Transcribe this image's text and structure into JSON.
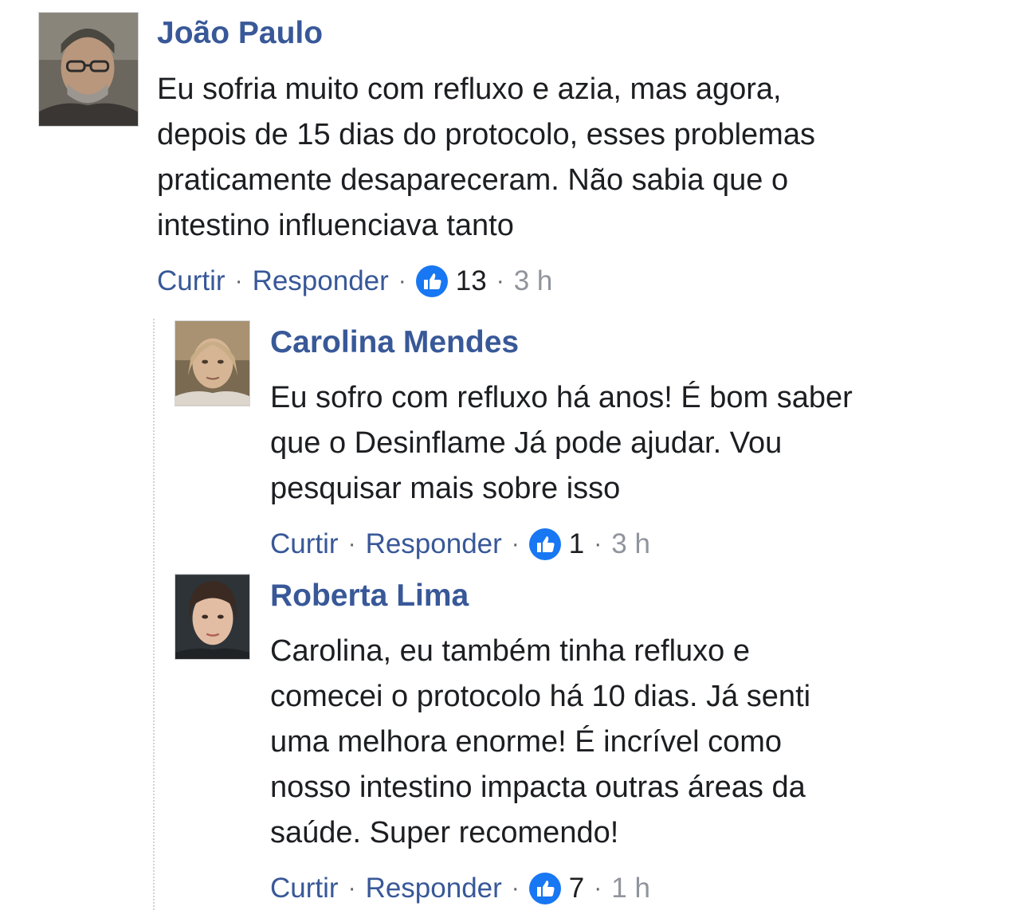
{
  "comments": [
    {
      "author": "João Paulo",
      "lines": [
        "Eu sofria muito com refluxo e azia, mas agora,",
        "depois de 15 dias do protocolo, esses problemas",
        "praticamente desapareceram. Não sabia que o",
        "intestino influenciava tanto"
      ],
      "like_label": "Curtir",
      "reply_label": "Responder",
      "separator": "·",
      "reaction_icon": "thumbs-up-icon",
      "reaction_count": "13",
      "time": "3 h"
    }
  ],
  "replies": [
    {
      "author": "Carolina Mendes",
      "lines": [
        "Eu sofro com refluxo há anos! É bom saber",
        "que o Desinflame Já pode ajudar. Vou",
        "pesquisar mais sobre isso"
      ],
      "like_label": "Curtir",
      "reply_label": "Responder",
      "separator": "·",
      "reaction_icon": "thumbs-up-icon",
      "reaction_count": "1",
      "time": "3 h"
    },
    {
      "author": "Roberta Lima",
      "lines": [
        "Carolina, eu também tinha refluxo e",
        "comecei o protocolo há 10 dias. Já senti",
        "uma melhora enorme! É incrível como",
        "nosso intestino impacta outras áreas da",
        "saúde. Super recomendo!"
      ],
      "like_label": "Curtir",
      "reply_label": "Responder",
      "separator": "·",
      "reaction_icon": "thumbs-up-icon",
      "reaction_count": "7",
      "time": "1 h"
    }
  ],
  "colors": {
    "link": "#385898",
    "text": "#1c1e21",
    "meta": "#90949c",
    "like_blue": "#1877f2"
  }
}
